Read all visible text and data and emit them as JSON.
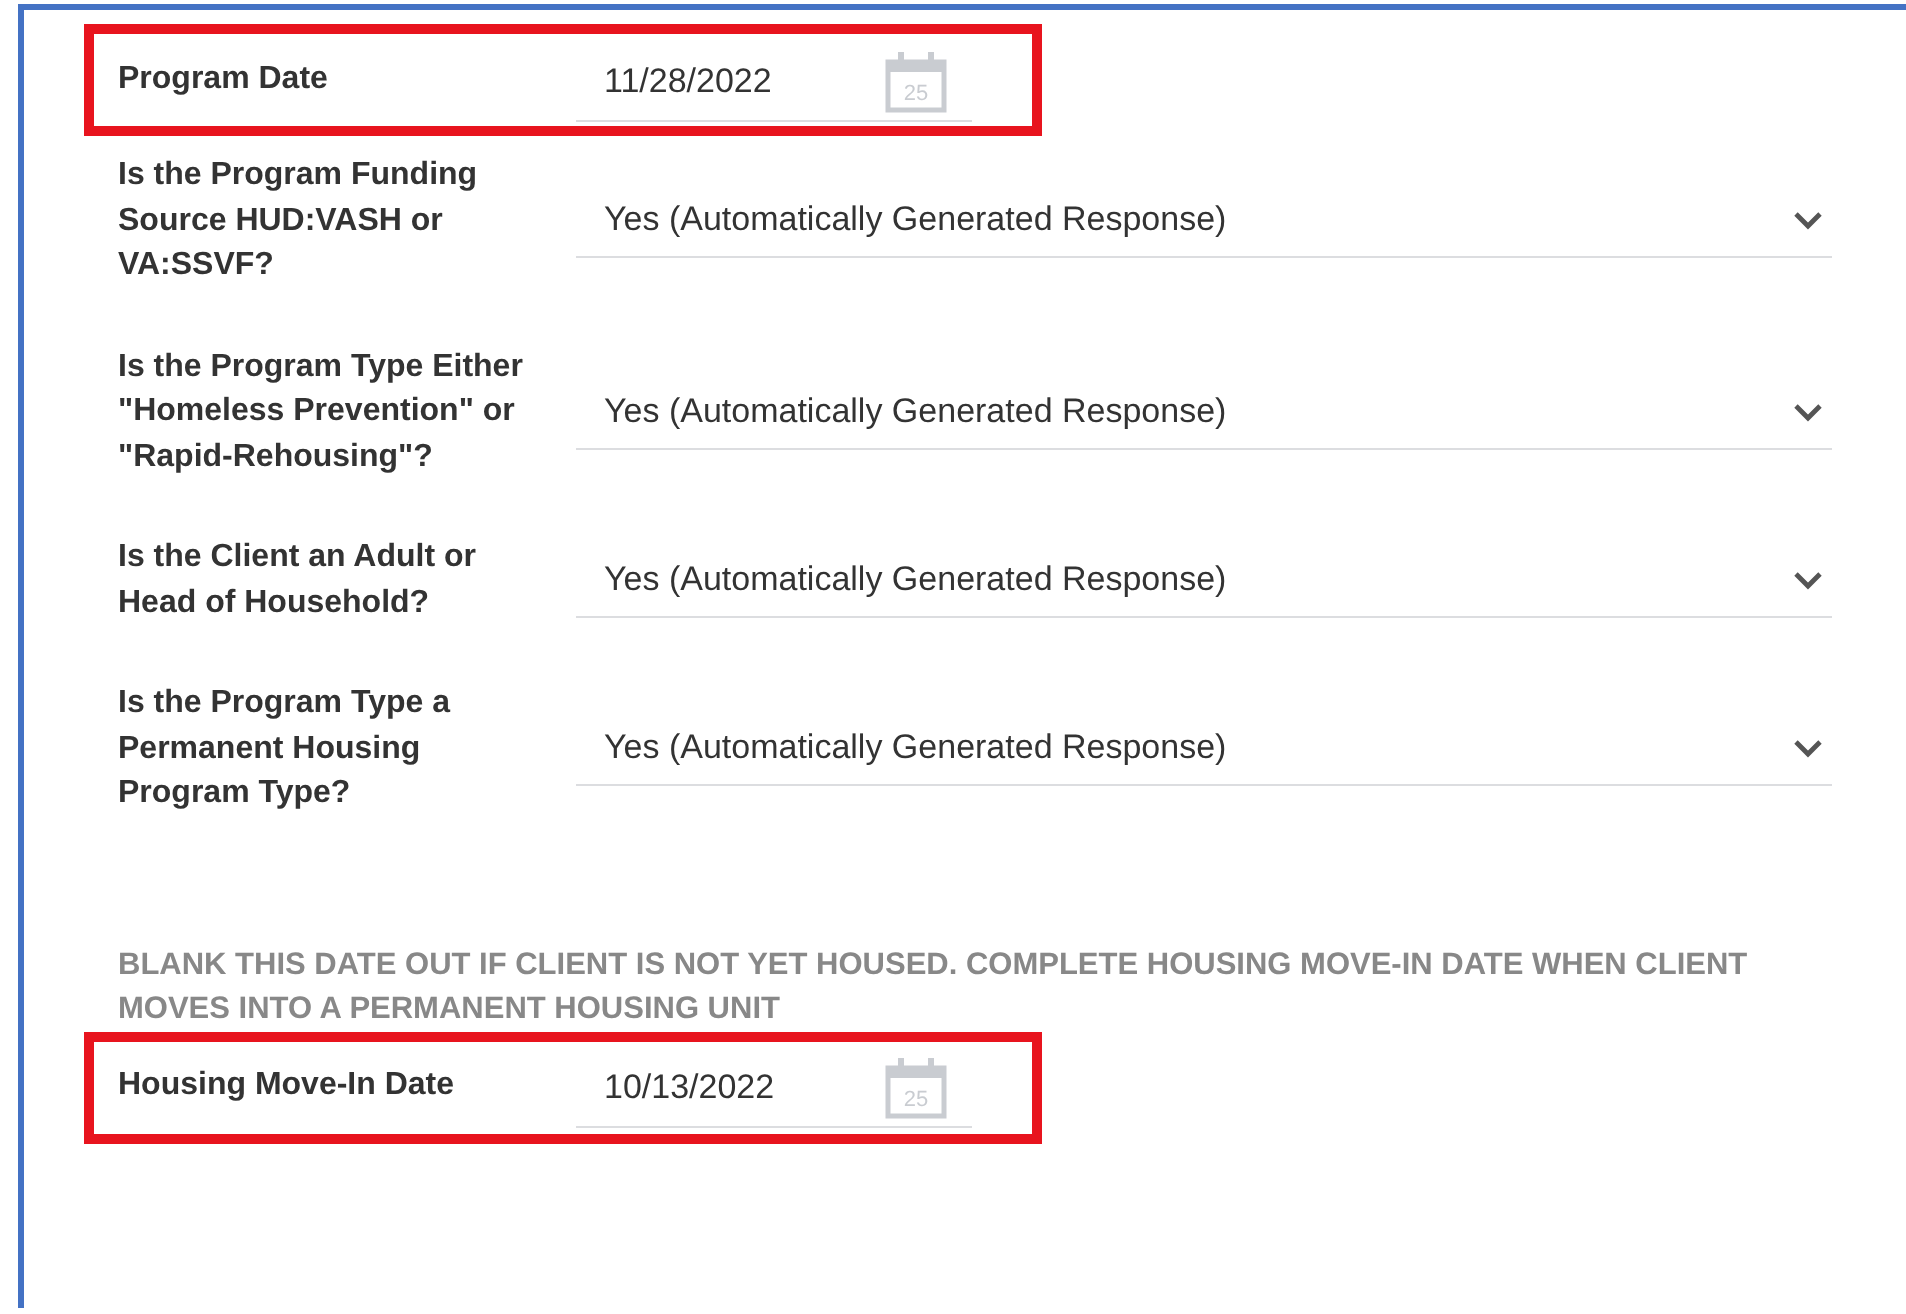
{
  "fields": [
    {
      "kind": "date",
      "label": "Program Date",
      "value": "11/28/2022",
      "calendar_day": "25",
      "highlighted": true
    },
    {
      "kind": "select",
      "label": "Is the Program Funding Source HUD:VASH or VA:SSVF?",
      "value": "Yes (Automatically Generated Response)"
    },
    {
      "kind": "select",
      "label": "Is the Program Type Either \"Homeless Prevention\" or \"Rapid-Rehousing\"?",
      "value": "Yes (Automatically Generated Response)"
    },
    {
      "kind": "select",
      "label": "Is the Client an Adult or Head of Household?",
      "value": "Yes (Automatically Generated Response)"
    },
    {
      "kind": "select",
      "label": "Is the Program Type a Permanent Housing Program Type?",
      "value": "Yes (Automatically Generated Response)"
    },
    {
      "kind": "note",
      "text": "BLANK THIS DATE OUT IF CLIENT IS NOT YET HOUSED. COMPLETE HOUSING MOVE-IN DATE WHEN CLIENT MOVES INTO A PERMANENT HOUSING UNIT"
    },
    {
      "kind": "date",
      "label": "Housing Move-In Date",
      "value": "10/13/2022",
      "calendar_day": "25",
      "highlighted": true
    }
  ]
}
